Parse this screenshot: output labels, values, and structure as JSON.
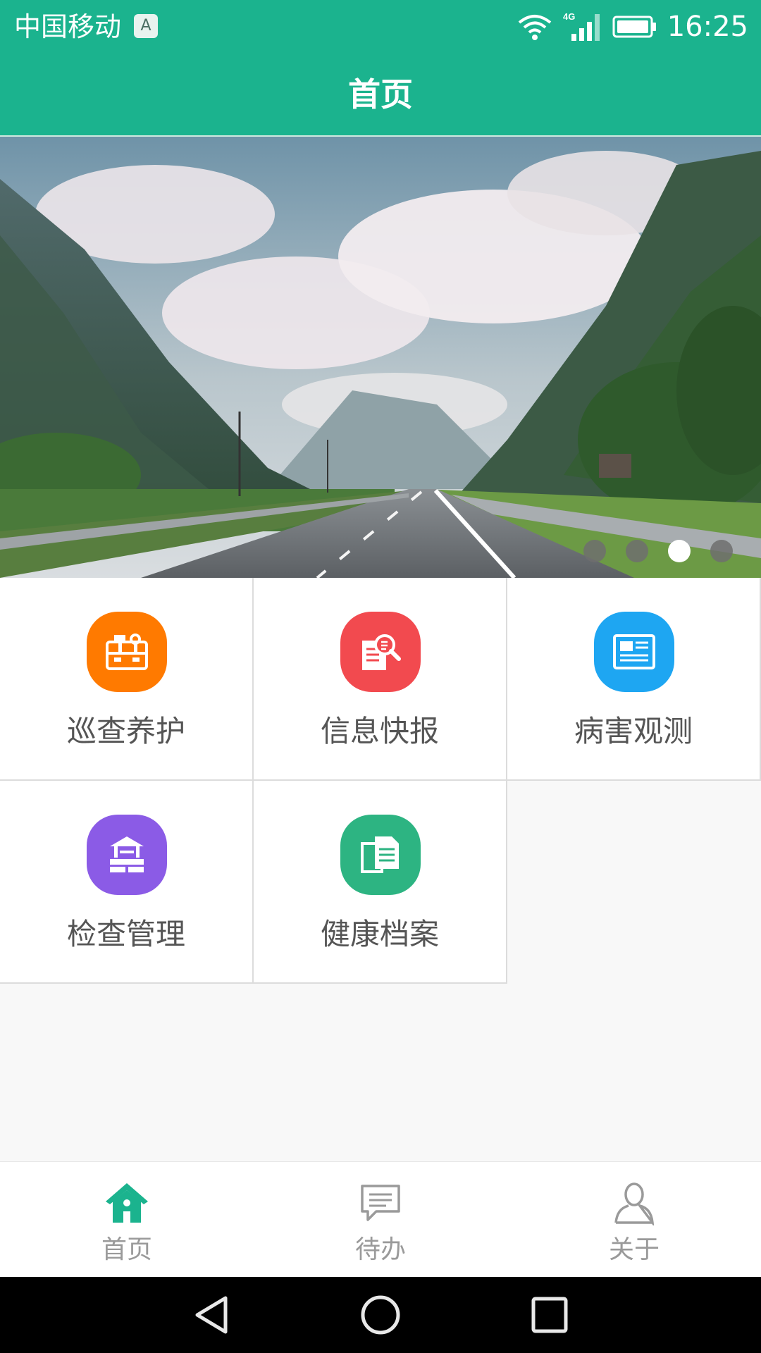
{
  "status_bar": {
    "carrier": "中国移动",
    "input_badge": "A",
    "network": "4G",
    "time": "16:25"
  },
  "header": {
    "title": "首页"
  },
  "banner": {
    "slide_count": 4,
    "active_index": 2
  },
  "menu": [
    {
      "label": "巡查养护",
      "icon": "toolbox-icon",
      "color": "#ff7a00"
    },
    {
      "label": "信息快报",
      "icon": "document-search-icon",
      "color": "#f24a4f"
    },
    {
      "label": "病害观测",
      "icon": "newspaper-icon",
      "color": "#1ea6f2"
    },
    {
      "label": "检查管理",
      "icon": "well-icon",
      "color": "#8b5be6"
    },
    {
      "label": "健康档案",
      "icon": "files-icon",
      "color": "#2db482"
    }
  ],
  "tabs": [
    {
      "label": "首页",
      "icon": "home-icon",
      "active": true
    },
    {
      "label": "待办",
      "icon": "message-icon",
      "active": false
    },
    {
      "label": "关于",
      "icon": "user-icon",
      "active": false
    }
  ],
  "colors": {
    "primary": "#1bb38e",
    "tab_active": "#1bb38e",
    "tab_inactive": "#9a9a9a"
  }
}
